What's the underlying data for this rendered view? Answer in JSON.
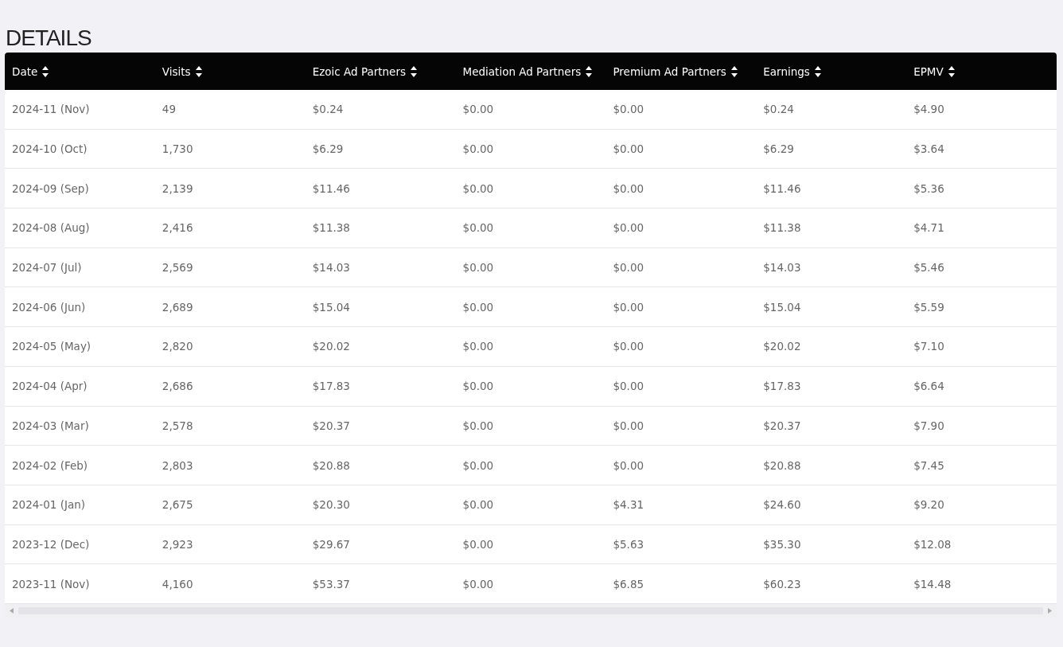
{
  "title": "DETAILS",
  "table": {
    "columns": [
      "Date",
      "Visits",
      "Ezoic Ad Partners",
      "Mediation Ad Partners",
      "Premium Ad Partners",
      "Earnings",
      "EPMV"
    ],
    "rows": [
      [
        "2024-11 (Nov)",
        "49",
        "$0.24",
        "$0.00",
        "$0.00",
        "$0.24",
        "$4.90"
      ],
      [
        "2024-10 (Oct)",
        "1,730",
        "$6.29",
        "$0.00",
        "$0.00",
        "$6.29",
        "$3.64"
      ],
      [
        "2024-09 (Sep)",
        "2,139",
        "$11.46",
        "$0.00",
        "$0.00",
        "$11.46",
        "$5.36"
      ],
      [
        "2024-08 (Aug)",
        "2,416",
        "$11.38",
        "$0.00",
        "$0.00",
        "$11.38",
        "$4.71"
      ],
      [
        "2024-07 (Jul)",
        "2,569",
        "$14.03",
        "$0.00",
        "$0.00",
        "$14.03",
        "$5.46"
      ],
      [
        "2024-06 (Jun)",
        "2,689",
        "$15.04",
        "$0.00",
        "$0.00",
        "$15.04",
        "$5.59"
      ],
      [
        "2024-05 (May)",
        "2,820",
        "$20.02",
        "$0.00",
        "$0.00",
        "$20.02",
        "$7.10"
      ],
      [
        "2024-04 (Apr)",
        "2,686",
        "$17.83",
        "$0.00",
        "$0.00",
        "$17.83",
        "$6.64"
      ],
      [
        "2024-03 (Mar)",
        "2,578",
        "$20.37",
        "$0.00",
        "$0.00",
        "$20.37",
        "$7.90"
      ],
      [
        "2024-02 (Feb)",
        "2,803",
        "$20.88",
        "$0.00",
        "$0.00",
        "$20.88",
        "$7.45"
      ],
      [
        "2024-01 (Jan)",
        "2,675",
        "$20.30",
        "$0.00",
        "$4.31",
        "$24.60",
        "$9.20"
      ],
      [
        "2023-12 (Dec)",
        "2,923",
        "$29.67",
        "$0.00",
        "$5.63",
        "$35.30",
        "$12.08"
      ],
      [
        "2023-11 (Nov)",
        "4,160",
        "$53.37",
        "$0.00",
        "$6.85",
        "$60.23",
        "$14.48"
      ]
    ]
  }
}
